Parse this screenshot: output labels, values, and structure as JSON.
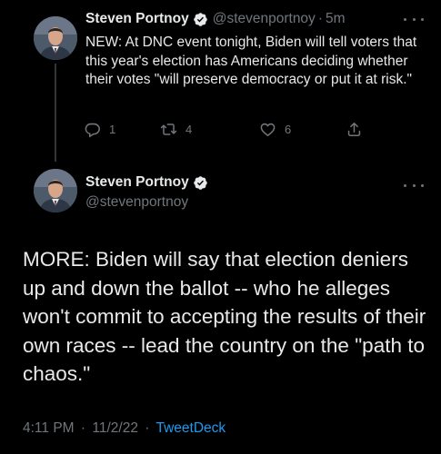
{
  "parent_tweet": {
    "author_name": "Steven Portnoy",
    "handle": "@stevenportnoy",
    "separator": "·",
    "age": "5m",
    "text": "NEW: At DNC event tonight, Biden will tell voters that this year's election has Americans deciding whether their votes \"will preserve democracy or put it at risk.\"",
    "reply_count": "1",
    "retweet_count": "4",
    "like_count": "6"
  },
  "focused_tweet": {
    "author_name": "Steven Portnoy",
    "handle": "@stevenportnoy",
    "text": "MORE: Biden will say that election deniers up and down the ballot -- who he alleges won't commit to accepting the results of their own races -- lead the country on the \"path to chaos.\"",
    "time": "4:11 PM",
    "separator": "·",
    "date": "11/2/22",
    "source": "TweetDeck"
  },
  "icons": {
    "verified": "verified-badge-icon",
    "more": "more-dots-icon",
    "reply": "reply-bubble-icon",
    "retweet": "retweet-icon",
    "like": "heart-icon",
    "share": "share-upload-icon"
  },
  "colors": {
    "background": "#000000",
    "text_primary": "#e7e9ea",
    "text_secondary": "#71767b",
    "accent": "#1d9bf0"
  }
}
